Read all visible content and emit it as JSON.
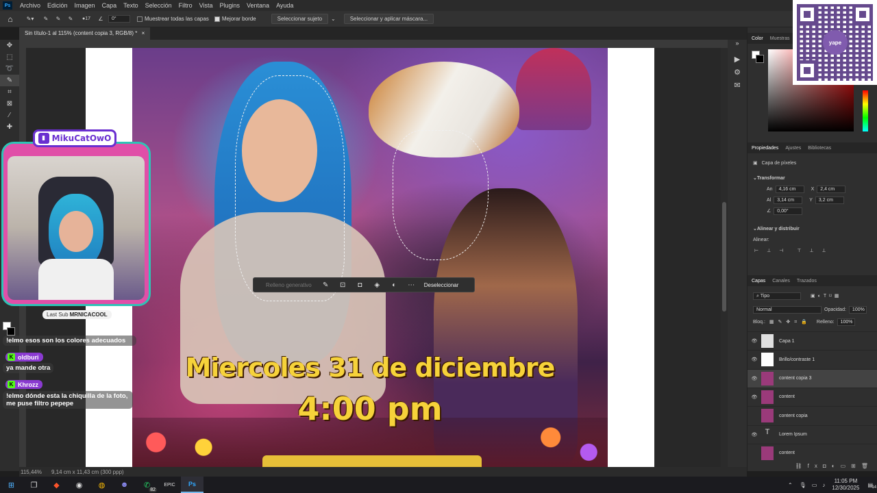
{
  "menubar": {
    "app_icon": "Ps",
    "items": [
      "Archivo",
      "Edición",
      "Imagen",
      "Capa",
      "Texto",
      "Selección",
      "Filtro",
      "Vista",
      "Plugins",
      "Ventana",
      "Ayuda"
    ]
  },
  "options": {
    "brush_size": "17",
    "angle": "0°",
    "sample_all_label": "Muestrear todas las capas",
    "enhance_edge_label": "Mejorar borde",
    "select_subject": "Seleccionar sujeto",
    "select_mask": "Seleccionar y aplicar máscara..."
  },
  "document": {
    "tab_title": "Sin título-1 al 115% (content copia 3, RGB/8) *",
    "zoom": "115,44%",
    "doc_info": "9,14 cm x 11,43 cm (300 ppp)"
  },
  "artwork": {
    "line1": "Miercoles 31 de diciembre",
    "line2": "4:00 pm"
  },
  "context_bar": {
    "generative_fill": "Relleno generativo",
    "deselect": "Deseleccionar"
  },
  "panels": {
    "color_tabs": [
      "Color",
      "Muestras"
    ],
    "props_tabs": [
      "Propiedades",
      "Ajustes",
      "Bibliotecas"
    ],
    "pixel_layer": "Capa de píxeles",
    "transform_label": "Transformar",
    "an_label": "An",
    "an": "4,16 cm",
    "x_label": "X",
    "x": "2,4 cm",
    "al_label": "Al",
    "al": "3,14 cm",
    "y_label": "Y",
    "y": "3,2 cm",
    "angle": "0,00°",
    "align_label": "Alinear y distribuir",
    "align_sub": "Alinear:",
    "layers_tabs": [
      "Capas",
      "Canales",
      "Trazados"
    ],
    "kind": "Tipo",
    "blend": "Normal",
    "opacity_label": "Opacidad:",
    "opacity": "100%",
    "lock_label": "Bloq.:",
    "fill_label": "Relleno:",
    "fill": "100%"
  },
  "layers": [
    {
      "name": "Capa 1",
      "visible": true,
      "selected": false,
      "thumb": "#e0e0e0"
    },
    {
      "name": "Brillo/contraste 1",
      "visible": true,
      "selected": false,
      "thumb": "#ffffff"
    },
    {
      "name": "content copia 3",
      "visible": true,
      "selected": true,
      "thumb": "#9a3a7a"
    },
    {
      "name": "content",
      "visible": true,
      "selected": false,
      "thumb": "#9a3a7a"
    },
    {
      "name": "content copia",
      "visible": false,
      "selected": false,
      "thumb": "#9a3a7a"
    },
    {
      "name": "Lorem Ipsum",
      "visible": true,
      "selected": false,
      "thumb": "T"
    },
    {
      "name": "content",
      "visible": false,
      "selected": false,
      "thumb": "#9a3a7a"
    }
  ],
  "overlay": {
    "channel": "MikuCatOwO",
    "qr_label": "yape",
    "last_sub_label": "Last Sub",
    "last_sub_user": "MRNICACOOL",
    "chat": [
      {
        "user": "",
        "msg": "!elmo esos son los colores adecuados"
      },
      {
        "user": "oldburi",
        "msg": "ya mande otra"
      },
      {
        "user": "Khrozz",
        "msg": "!elmo dónde esta la chiquilla de la foto, me puse filtro pepepe"
      }
    ]
  },
  "taskbar": {
    "badge_count": "82",
    "time": "11:05 PM",
    "date": "12/30/2025",
    "notif": "14"
  },
  "colors": {
    "ps_bg": "#323232",
    "accent_title": "#f6d23a",
    "overlay_border": "#2ec4b6",
    "twitch_purple": "#6a2fd0",
    "kick_green": "#53fc18"
  }
}
